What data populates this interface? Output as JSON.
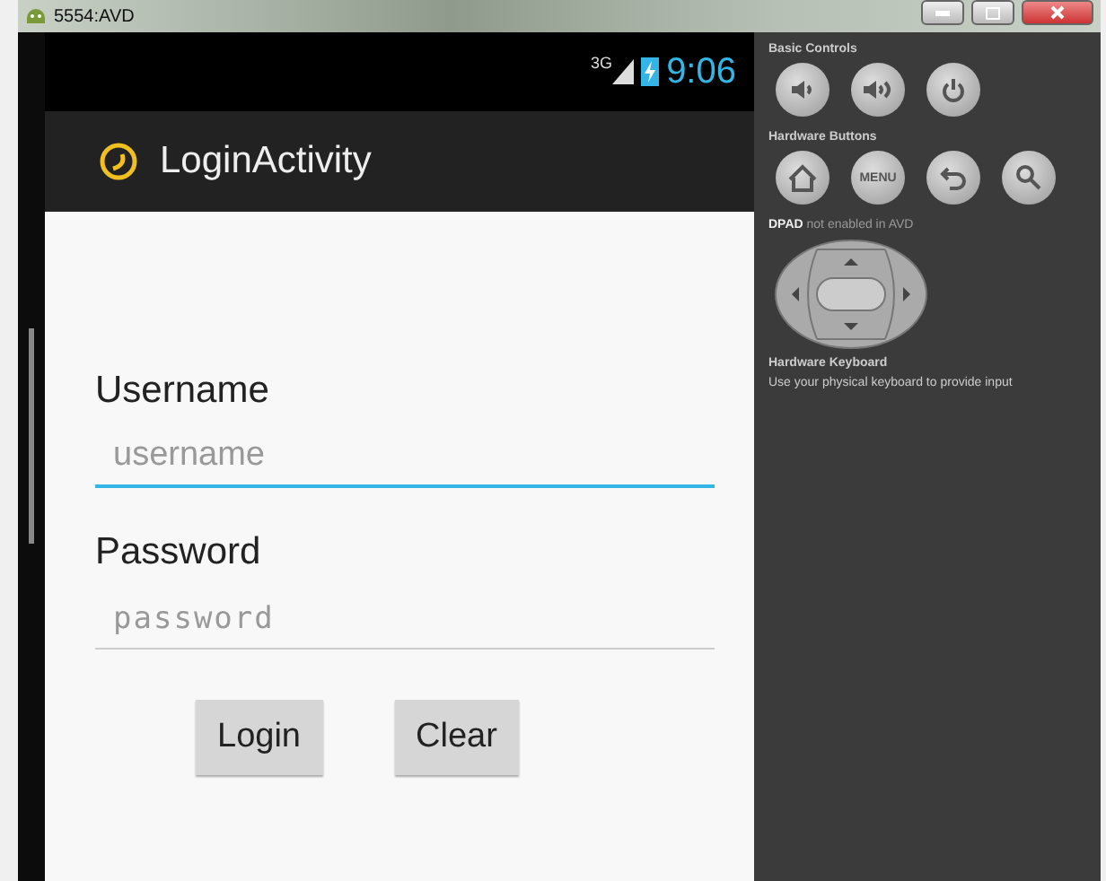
{
  "window": {
    "title": "5554:AVD"
  },
  "status_bar": {
    "network": "3G",
    "time": "9:06"
  },
  "action_bar": {
    "title": "LoginActivity"
  },
  "form": {
    "fields": [
      {
        "label": "Username",
        "placeholder": "username",
        "focused": true,
        "kind": "text"
      },
      {
        "label": "Password",
        "placeholder": "password",
        "focused": false,
        "kind": "password"
      }
    ],
    "buttons": [
      "Login",
      "Clear"
    ]
  },
  "controls_panel": {
    "sections": [
      {
        "title": "Basic Controls",
        "kind": "buttons",
        "buttons": [
          {
            "kind": "icon"
          },
          {
            "kind": "icon"
          },
          {
            "kind": "icon"
          }
        ]
      },
      {
        "title": "Hardware Buttons",
        "kind": "buttons",
        "buttons": [
          {
            "kind": "icon"
          },
          {
            "kind": "text",
            "text": "MENU"
          },
          {
            "kind": "icon"
          },
          {
            "kind": "icon"
          }
        ]
      },
      {
        "title": "**DPAD** not enabled in AVD",
        "kind": "dpad"
      },
      {
        "title": "Hardware Keyboard",
        "kind": "note",
        "text": "Use your physical keyboard to provide input"
      }
    ]
  }
}
